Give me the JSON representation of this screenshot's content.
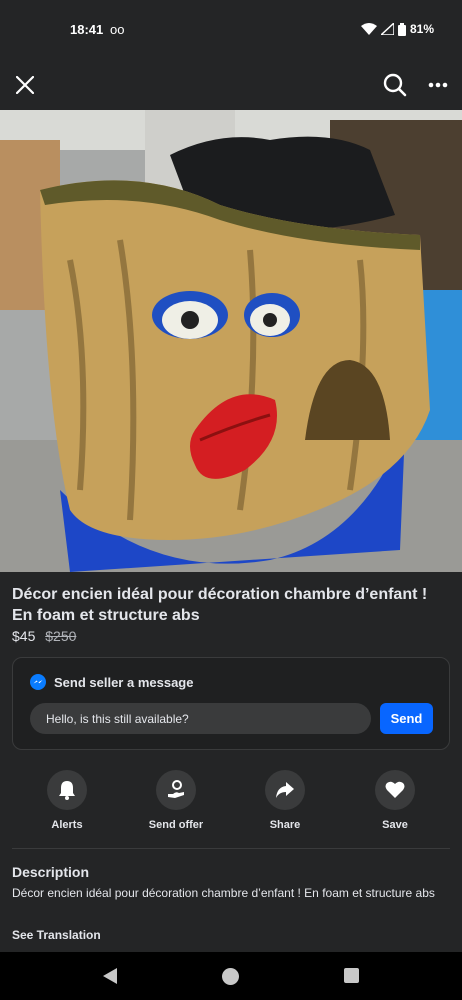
{
  "status": {
    "time": "18:41",
    "voicemail": "oo",
    "battery": "81%"
  },
  "nav": {
    "close_icon": "close-icon",
    "search_icon": "search-icon",
    "more_icon": "more-icon"
  },
  "listing": {
    "title": "Décor encien idéal pour décoration chambre d’enfant ! En foam et structure abs",
    "price": "$45",
    "original_price": "$250"
  },
  "message": {
    "header": "Send seller a message",
    "input_value": "Hello, is this still available?",
    "send_label": "Send"
  },
  "actions": [
    {
      "label": "Alerts",
      "icon": "bell-icon"
    },
    {
      "label": "Send offer",
      "icon": "send-offer-icon"
    },
    {
      "label": "Share",
      "icon": "share-icon"
    },
    {
      "label": "Save",
      "icon": "heart-icon"
    }
  ],
  "description": {
    "heading": "Description",
    "text": "Décor encien idéal pour décoration chambre d’enfant ! En foam et structure abs",
    "translation_link": "See Translation"
  },
  "colors": {
    "accent": "#0866ff",
    "background": "#242526",
    "surface": "#3a3b3c"
  }
}
